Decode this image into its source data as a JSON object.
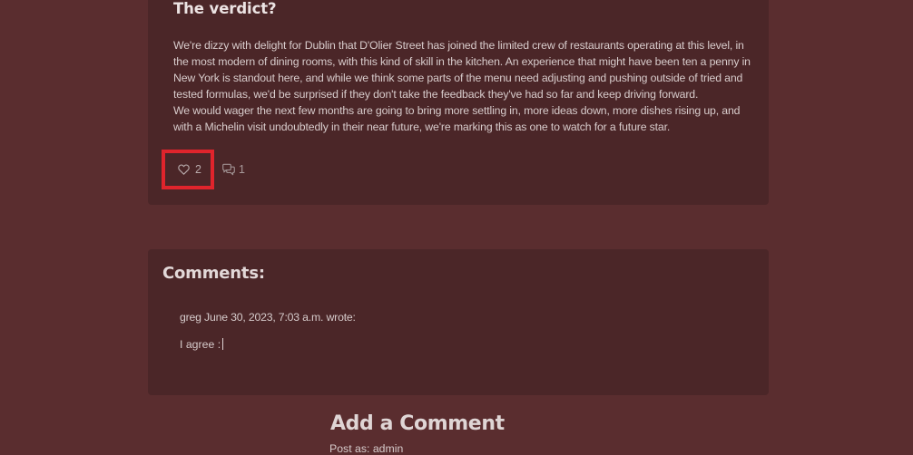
{
  "post": {
    "title": "The verdict?",
    "paragraph1": "We're dizzy with delight for Dublin that D'Olier Street has joined the limited crew of restaurants operating at this level, in the most modern of dining rooms, with this kind of skill in the kitchen. An experience that might have been ten a penny in New York is standout here, and while we think some parts of the menu need adjusting and pushing outside of tried and tested formulas, we'd be surprised if they don't take the feedback they've had so far and keep driving forward.",
    "paragraph2": "We would wager the next few months are going to bring more settling in, more ideas down, more dishes rising up, and with a Michelin visit undoubtedly in their near future, we're marking this as one to watch for a future star.",
    "like_count": "2",
    "comment_count": "1",
    "like_icon": "heart-icon",
    "comment_icon": "speech-bubbles-icon"
  },
  "comments": {
    "heading": "Comments:",
    "items": [
      {
        "meta": "greg June 30, 2023, 7:03 a.m. wrote:",
        "text": "I agree :"
      }
    ]
  },
  "add_comment": {
    "title": "Add a Comment",
    "post_as": "Post as: admin"
  },
  "colors": {
    "page_background": "#5a2d2f",
    "card_background": "#4b2628",
    "highlight_border": "#e0242c"
  }
}
